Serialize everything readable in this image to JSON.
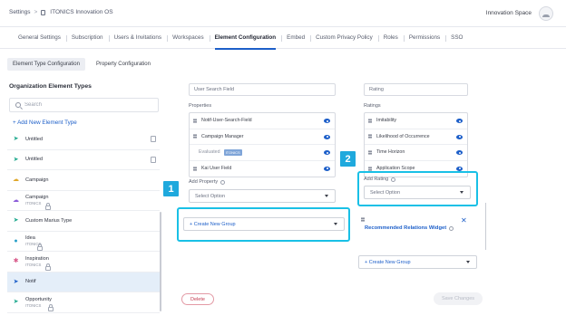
{
  "header": {
    "breadcrumb_root": "Settings",
    "breadcrumb_sep": ">",
    "breadcrumb_current": "ITONICS Innovation OS",
    "space_label": "Innovation Space"
  },
  "tabs": [
    {
      "label": "General Settings"
    },
    {
      "label": "Subscription"
    },
    {
      "label": "Users & Invitations"
    },
    {
      "label": "Workspaces"
    },
    {
      "label": "Element Configuration",
      "active": true
    },
    {
      "label": "Embed"
    },
    {
      "label": "Custom Privacy Policy"
    },
    {
      "label": "Roles"
    },
    {
      "label": "Permissions"
    },
    {
      "label": "SSO"
    }
  ],
  "subtabs": [
    {
      "label": "Element Type Configuration",
      "active": true
    },
    {
      "label": "Property Configuration"
    }
  ],
  "sidebar": {
    "title": "Organization Element Types",
    "search_placeholder": "Search",
    "add_label": "+ Add New Element Type",
    "items": [
      {
        "name": "Untitled",
        "sub": "",
        "icon": "rocket-icon",
        "right": "document-icon"
      },
      {
        "name": "Untitled",
        "sub": "",
        "icon": "rocket-icon",
        "right": "document-icon"
      },
      {
        "name": "Campaign",
        "sub": "",
        "icon": "campaign-icon",
        "right": ""
      },
      {
        "name": "Campaign",
        "sub": "ITONICS",
        "icon": "campaign-icon",
        "right": "lock-icon"
      },
      {
        "name": "Custom Marius Type",
        "sub": "",
        "icon": "rocket-icon",
        "right": ""
      },
      {
        "name": "Idea",
        "sub": "ITONICS",
        "icon": "idea-icon",
        "right": "lock-icon"
      },
      {
        "name": "Inspiration",
        "sub": "ITONICS",
        "icon": "inspiration-icon",
        "right": "lock-icon"
      },
      {
        "name": "Notif",
        "sub": "",
        "icon": "rocket-icon",
        "right": "",
        "active": true
      },
      {
        "name": "Opportunity",
        "sub": "ITONICS",
        "icon": "opportunity-icon",
        "right": "lock-icon"
      }
    ]
  },
  "left_column": {
    "top_field": "User Search Field",
    "properties_label": "Properties",
    "properties": [
      {
        "label": "Notif-User-Search-Field",
        "visible": true
      },
      {
        "label": "Campaign Manager",
        "visible": true
      },
      {
        "label": "Evaluated",
        "tag": "ITONICS",
        "indent": true,
        "visible": true
      },
      {
        "label": "Kai User Field",
        "visible": true
      }
    ],
    "add_property_label": "Add Property",
    "add_property_placeholder": "Select Option",
    "create_group_label": "+ Create New Group"
  },
  "right_column": {
    "top_field": "Rating",
    "ratings_label": "Ratings",
    "ratings": [
      {
        "label": "Imitability",
        "visible": true
      },
      {
        "label": "Likelihood of Occurrence",
        "visible": true
      },
      {
        "label": "Time Horizon",
        "visible": true
      },
      {
        "label": "Application Scope",
        "visible": true
      }
    ],
    "add_rating_label": "Add Rating",
    "add_rating_placeholder": "Select Option",
    "widget_label": "Recommended Relations Widget",
    "create_group_label": "+ Create New Group"
  },
  "callouts": {
    "one": "1",
    "two": "2"
  },
  "footer": {
    "delete_label": "Delete",
    "save_label": "Save Changes"
  },
  "colors": {
    "accent": "#1d5fc9",
    "highlight": "#19c0e6",
    "badge": "#1fa9dd",
    "danger": "#c43a4f"
  }
}
